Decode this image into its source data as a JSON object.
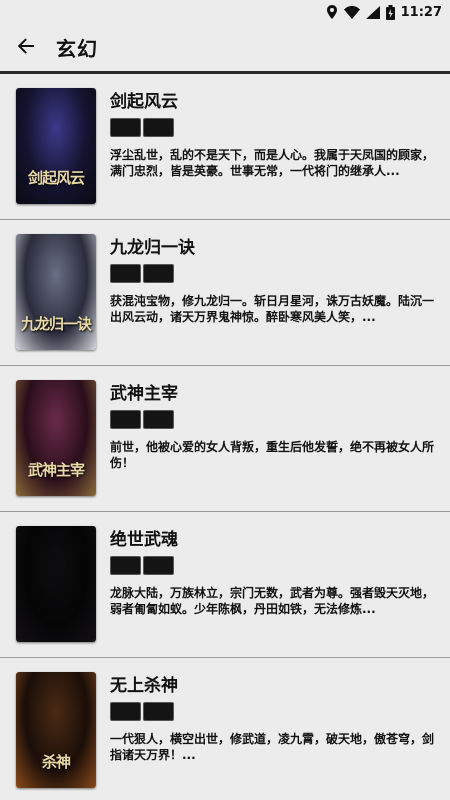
{
  "status": {
    "time": "11:27"
  },
  "appbar": {
    "title": "玄幻"
  },
  "books": [
    {
      "title": "剑起风云",
      "desc": "浮尘乱世，乱的不是天下，而是人心。我属于天凤国的顾家，满门忠烈，皆是英豪。世事无常，一代将门的继承人...",
      "cover_text": "剑起风云",
      "cover_colors": [
        "#3b3a8a",
        "#14122e",
        "#0a0a12"
      ]
    },
    {
      "title": "九龙归一诀",
      "desc": "获混沌宝物，修九龙归一。斩日月星河，诛万古妖魔。陆沉一出风云动，诸天万界鬼神惊。醉卧寒风美人笑，...",
      "cover_text": "九龙归一诀",
      "cover_colors": [
        "#6a6f86",
        "#2a2c3c",
        "#d6d6dc"
      ]
    },
    {
      "title": "武神主宰",
      "desc": "前世，他被心爱的女人背叛，重生后他发誓，绝不再被女人所伤！",
      "cover_text": "武神主宰",
      "cover_colors": [
        "#6a2a4a",
        "#2a0e1a",
        "#8a6a3a"
      ]
    },
    {
      "title": "绝世武魂",
      "desc": "龙脉大陆，万族林立，宗门无数，武者为尊。强者毁天灭地，弱者匍匐如蚁。少年陈枫，丹田如铁，无法修炼...",
      "cover_text": "",
      "cover_colors": [
        "#0e0e10",
        "#050506",
        "#141014"
      ]
    },
    {
      "title": "无上杀神",
      "desc": "一代狠人，横空出世，修武道，凌九霄，破天地，傲苍穹，剑指诸天万界！...",
      "cover_text": "杀神",
      "cover_colors": [
        "#4a2a14",
        "#1a0e08",
        "#8a4a1a"
      ]
    }
  ]
}
